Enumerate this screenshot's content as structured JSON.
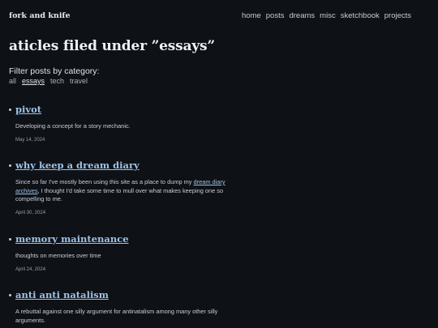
{
  "site": {
    "brand": "fork and knife"
  },
  "nav": [
    "home",
    "posts",
    "dreams",
    "misc",
    "sketchbook",
    "projects"
  ],
  "page": {
    "title": "aticles filed under ”essays”"
  },
  "filter": {
    "label": "Filter posts by category:",
    "categories": [
      "all",
      "essays",
      "tech",
      "travel"
    ],
    "active": "essays"
  },
  "posts": [
    {
      "title": "pivot",
      "excerpt_before": "Developing a concept for a story mechanic.",
      "excerpt_link": "",
      "excerpt_after": "",
      "date": "May 14, 2024"
    },
    {
      "title": "why keep a dream diary",
      "excerpt_before": "Since so far I've mostly been using this site as a place to dump my ",
      "excerpt_link": "dream diary archives",
      "excerpt_after": ", I thought I'd take some time to mull over what makes keeping one so compelling to me.",
      "date": "April 30, 2024"
    },
    {
      "title": "memory maintenance",
      "excerpt_before": "thoughts on memories over time",
      "excerpt_link": "",
      "excerpt_after": "",
      "date": "April 24, 2024"
    },
    {
      "title": "anti anti natalism",
      "excerpt_before": "A rebuttal against one silly argument for antinatalism among many other silly arguments.",
      "excerpt_link": "",
      "excerpt_after": "",
      "date": ""
    }
  ]
}
